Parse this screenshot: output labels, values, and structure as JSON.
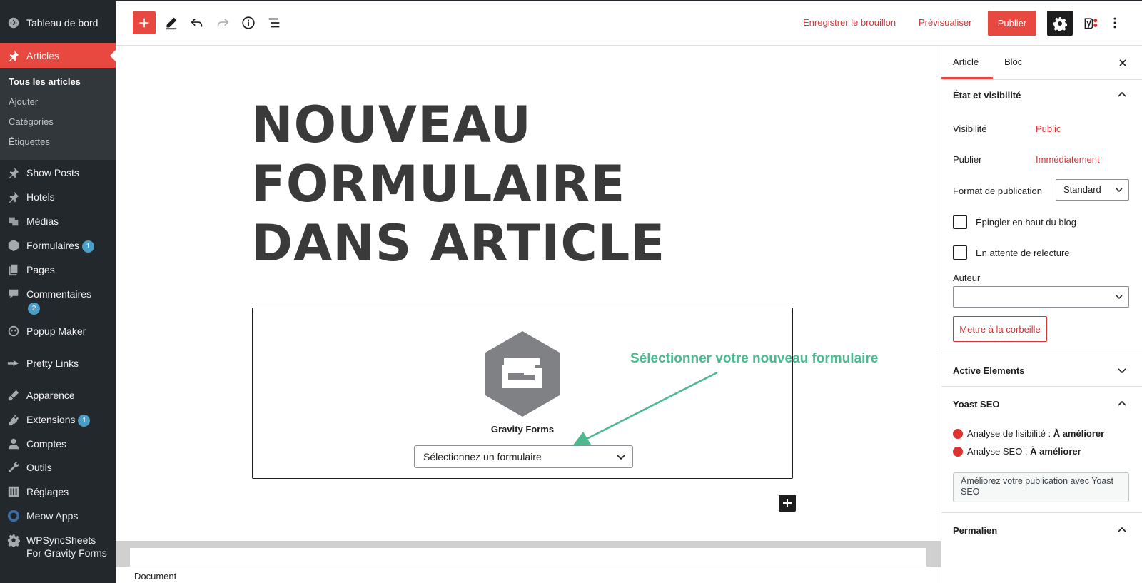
{
  "sidebar": {
    "items": [
      {
        "label": "Tableau de bord",
        "icon": "dashboard-icon"
      },
      {
        "label": "Articles",
        "icon": "pin-icon",
        "active": true
      },
      {
        "label": "Show Posts",
        "icon": "pin-icon"
      },
      {
        "label": "Hotels",
        "icon": "pin-icon"
      },
      {
        "label": "Médias",
        "icon": "media-icon"
      },
      {
        "label": "Formulaires",
        "icon": "forms-icon",
        "badge": "1"
      },
      {
        "label": "Pages",
        "icon": "pages-icon"
      },
      {
        "label": "Commentaires",
        "icon": "comments-icon",
        "badge": "2"
      },
      {
        "label": "Popup Maker",
        "icon": "popup-icon"
      },
      {
        "label": "Pretty Links",
        "icon": "pretty-links-icon"
      },
      {
        "label": "Apparence",
        "icon": "appearance-icon"
      },
      {
        "label": "Extensions",
        "icon": "plugins-icon",
        "badge": "1"
      },
      {
        "label": "Comptes",
        "icon": "users-icon"
      },
      {
        "label": "Outils",
        "icon": "tools-icon"
      },
      {
        "label": "Réglages",
        "icon": "settings-sliders-icon"
      },
      {
        "label": "Meow Apps",
        "icon": "meow-icon"
      },
      {
        "label": "WPSyncSheets For Gravity Forms",
        "icon": "gear-icon"
      }
    ],
    "submenu": [
      "Tous les articles",
      "Ajouter",
      "Catégories",
      "Étiquettes"
    ]
  },
  "toolbar": {
    "save_draft": "Enregistrer le brouillon",
    "preview": "Prévisualiser",
    "publish": "Publier"
  },
  "editor": {
    "title": "NOUVEAU FORMULAIRE DANS ARTICLE",
    "block": {
      "name": "Gravity Forms",
      "select_placeholder": "Sélectionnez un formulaire"
    },
    "annotation": "Sélectionner votre nouveau formulaire",
    "breadcrumb": "Document"
  },
  "settings": {
    "tabs": [
      "Article",
      "Bloc"
    ],
    "status_panel": {
      "title": "État et visibilité",
      "visibility_label": "Visibilité",
      "visibility_value": "Public",
      "publish_label": "Publier",
      "publish_value": "Immédiatement",
      "format_label": "Format de publication",
      "format_value": "Standard",
      "sticky_label": "Épingler en haut du blog",
      "pending_label": "En attente de relecture",
      "author_label": "Auteur",
      "trash_label": "Mettre à la corbeille"
    },
    "active_elements_title": "Active Elements",
    "yoast": {
      "title": "Yoast SEO",
      "readability_label": "Analyse de lisibilité :",
      "readability_value": "À améliorer",
      "seo_label": "Analyse SEO :",
      "seo_value": "À améliorer",
      "cta": "Améliorez votre publication avec Yoast SEO"
    },
    "permalink_title": "Permalien"
  },
  "colors": {
    "accent": "#e7483f",
    "sidebar_bg": "#23282d",
    "link_red": "#d63638",
    "annotation_green": "#4cb98f"
  }
}
